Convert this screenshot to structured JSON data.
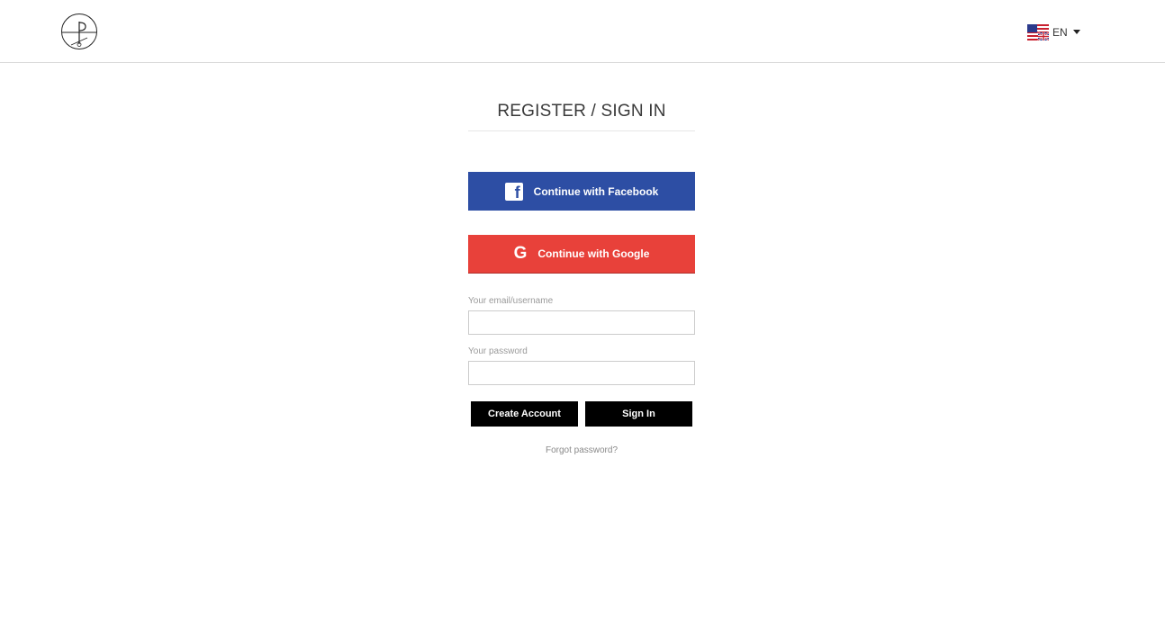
{
  "header": {
    "logo_icon": "p-compass-logo-icon",
    "language": {
      "flag_icon": "us-uk-flag-icon",
      "label": "EN",
      "dropdown_icon": "caret-down-icon"
    }
  },
  "auth": {
    "title": "REGISTER / SIGN IN",
    "facebook": {
      "label": "Continue with Facebook",
      "icon": "facebook-icon",
      "color": "#2d4ea4"
    },
    "google": {
      "label": "Continue with Google",
      "icon": "google-icon",
      "color": "#e8413a"
    },
    "email_field": {
      "label": "Your email/username",
      "value": "",
      "placeholder": ""
    },
    "password_field": {
      "label": "Your password",
      "value": "",
      "placeholder": ""
    },
    "create_account_label": "Create Account",
    "sign_in_label": "Sign In",
    "forgot_password_label": "Forgot password?"
  }
}
